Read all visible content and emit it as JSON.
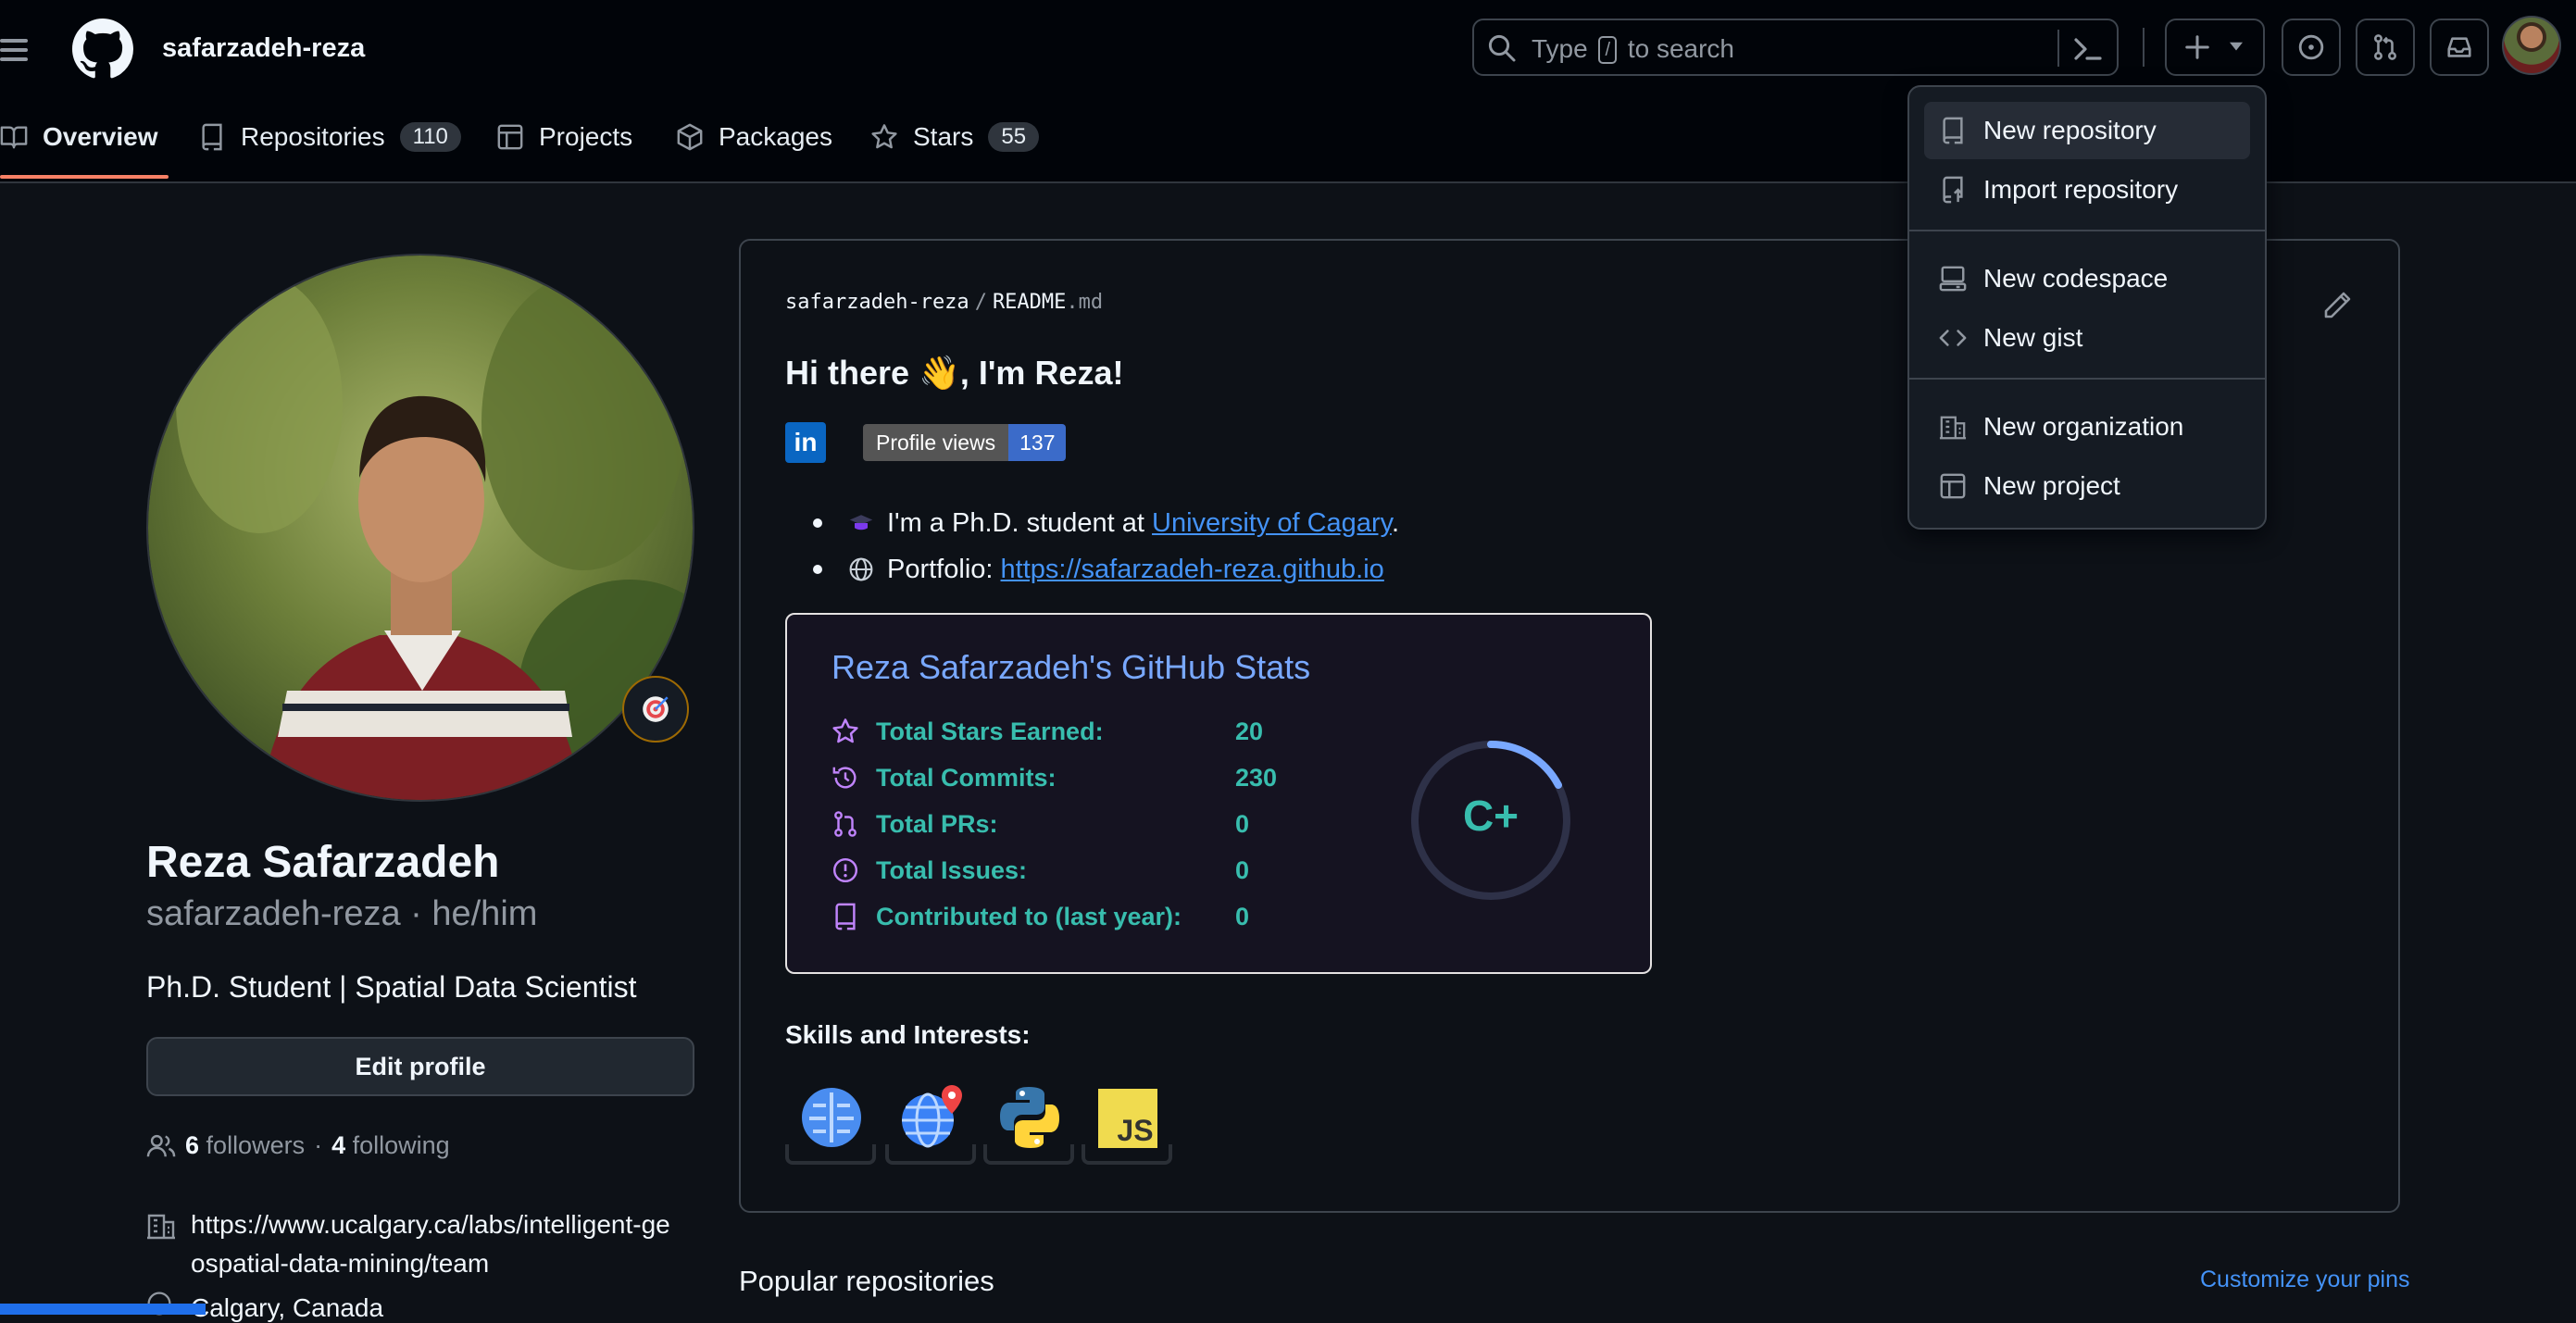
{
  "header": {
    "username": "safarzadeh-reza",
    "search": {
      "before": "Type",
      "key": "/",
      "after": "to search"
    }
  },
  "tabs": [
    {
      "label": "Overview"
    },
    {
      "label": "Repositories",
      "count": "110"
    },
    {
      "label": "Projects"
    },
    {
      "label": "Packages"
    },
    {
      "label": "Stars",
      "count": "55"
    }
  ],
  "profile": {
    "name": "Reza Safarzadeh",
    "login_pronouns": "safarzadeh-reza · he/him",
    "bio": "Ph.D. Student | Spatial Data Scientist",
    "edit_label": "Edit profile",
    "followers": "6",
    "followers_label": "followers",
    "dot": "·",
    "following": "4",
    "following_label": "following",
    "website": "https://www.ucalgary.ca/labs/intelligent-geospatial-data-mining/team",
    "location": "Calgary, Canada"
  },
  "readme": {
    "owner": "safarzadeh-reza",
    "sep": "/",
    "file": "README",
    "ext": ".md",
    "greeting": "Hi there 👋, I'm Reza!",
    "linkedin": "in",
    "views_label": "Profile views",
    "views_count": "137",
    "bullet1_prefix": "I'm a Ph.D. student at",
    "bullet1_link": "University of Cagary",
    "bullet1_suffix": ".",
    "bullet2_prefix": "Portfolio:",
    "bullet2_link": "https://safarzadeh-reza.github.io",
    "stats": {
      "title": "Reza Safarzadeh's GitHub Stats",
      "rows": [
        {
          "label": "Total Stars Earned:",
          "value": "20"
        },
        {
          "label": "Total Commits:",
          "value": "230"
        },
        {
          "label": "Total PRs:",
          "value": "0"
        },
        {
          "label": "Total Issues:",
          "value": "0"
        },
        {
          "label": "Contributed to (last year):",
          "value": "0"
        }
      ],
      "grade": "C+"
    },
    "skills_title": "Skills and Interests:"
  },
  "popular_title": "Popular repositories",
  "customize_label": "Customize your pins",
  "menu": {
    "items": [
      {
        "label": "New repository"
      },
      {
        "label": "Import repository"
      },
      {
        "label": "New codespace"
      },
      {
        "label": "New gist"
      },
      {
        "label": "New organization"
      },
      {
        "label": "New project"
      }
    ]
  },
  "colors": {
    "accent": "#f78166",
    "link": "#4493f8",
    "stats_title": "#79a8ff",
    "stats_text": "#38bdae",
    "stats_icon": "#c084fc"
  }
}
